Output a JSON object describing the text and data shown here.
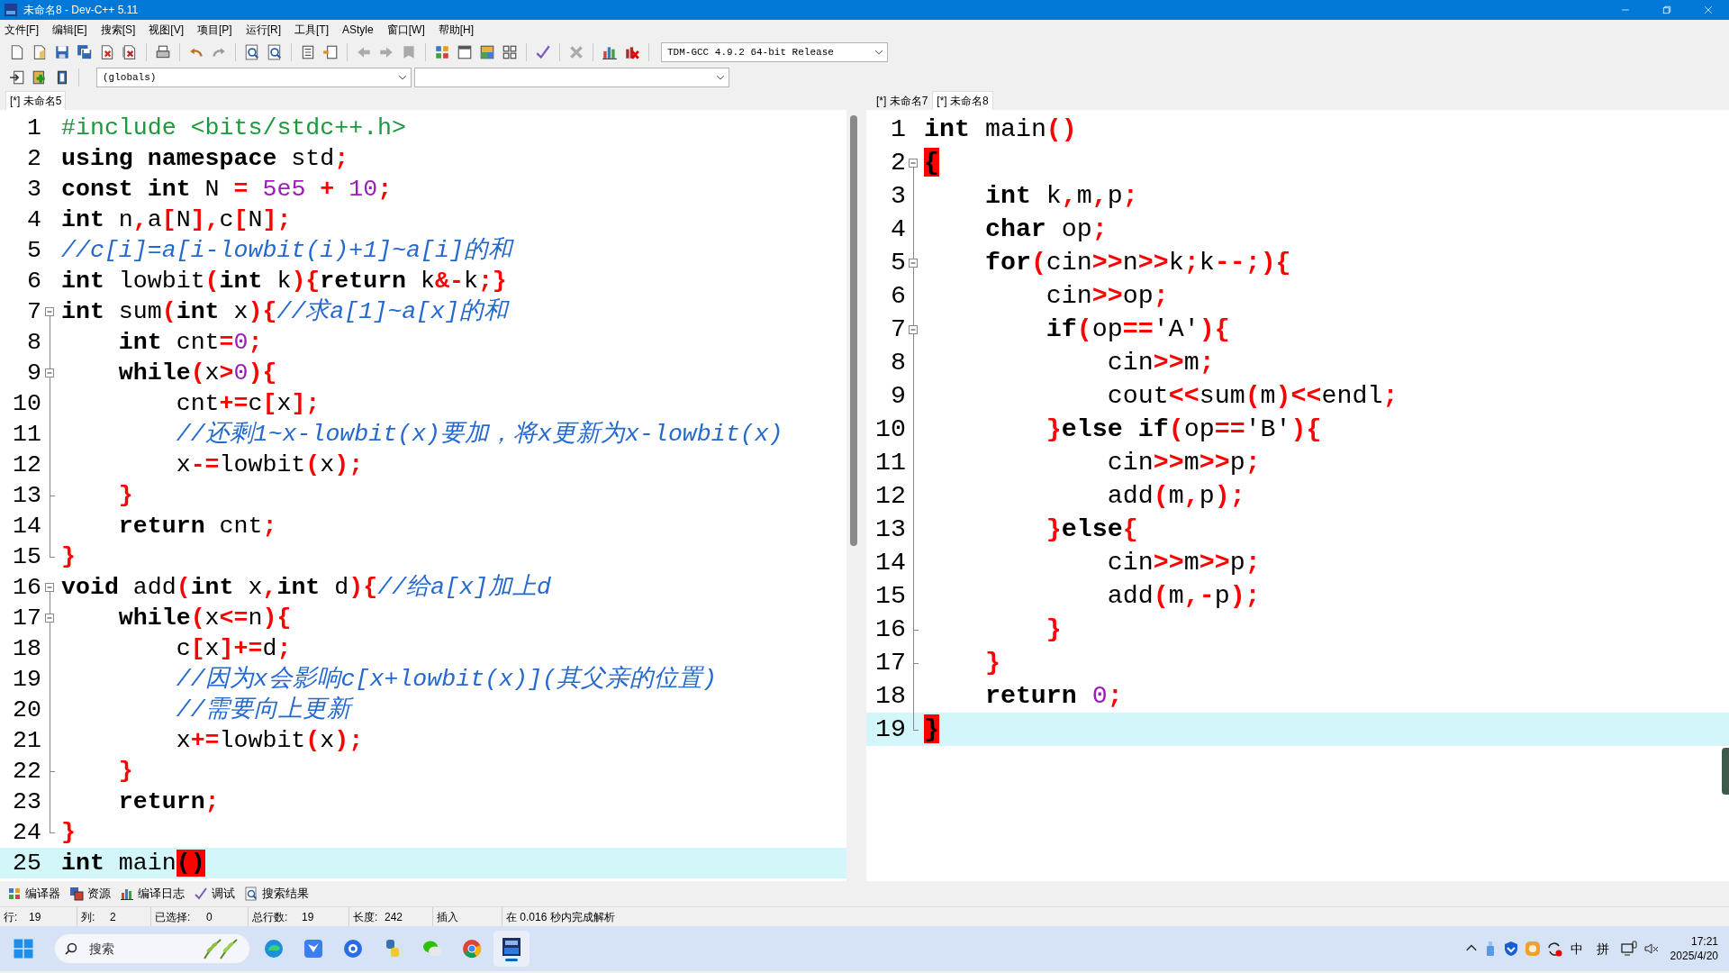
{
  "window": {
    "title": "未命名8 - Dev-C++ 5.11"
  },
  "menu": [
    "文件[F]",
    "编辑[E]",
    "搜索[S]",
    "视图[V]",
    "项目[P]",
    "运行[R]",
    "工具[T]",
    "AStyle",
    "窗口[W]",
    "帮助[H]"
  ],
  "toolbar": {
    "compiler": "TDM-GCC 4.9.2 64-bit Release",
    "scope": "(globals)"
  },
  "editors": [
    {
      "tabs": [
        {
          "label": "[*] 未命名5",
          "selected": true
        }
      ],
      "lines": [
        {
          "n": "1",
          "current": false,
          "t": [
            {
              "kind": "preprocessor",
              "text": "#include <bits/stdc++.h>"
            }
          ]
        },
        {
          "n": "2",
          "current": false,
          "t": [
            {
              "kind": "keyword",
              "text": "using"
            },
            {
              "kind": "keyword",
              "text": " namespace"
            },
            {
              "kind": "plain",
              "text": " std"
            },
            {
              "kind": "symbol",
              "text": ";"
            }
          ]
        },
        {
          "n": "3",
          "current": false,
          "t": [
            {
              "kind": "keyword",
              "text": "const"
            },
            {
              "kind": "keyword",
              "text": " int"
            },
            {
              "kind": "plain",
              "text": " N "
            },
            {
              "kind": "symbol",
              "text": "="
            },
            {
              "kind": "number",
              "text": " 5e5"
            },
            {
              "kind": "symbol",
              "text": " +"
            },
            {
              "kind": "number",
              "text": " 10"
            },
            {
              "kind": "symbol",
              "text": ";"
            }
          ]
        },
        {
          "n": "4",
          "current": false,
          "t": [
            {
              "kind": "keyword",
              "text": "int"
            },
            {
              "kind": "plain",
              "text": " n"
            },
            {
              "kind": "symbol",
              "text": ","
            },
            {
              "kind": "plain",
              "text": "a"
            },
            {
              "kind": "symbol",
              "text": "["
            },
            {
              "kind": "plain",
              "text": "N"
            },
            {
              "kind": "symbol",
              "text": "],"
            },
            {
              "kind": "plain",
              "text": "c"
            },
            {
              "kind": "symbol",
              "text": "["
            },
            {
              "kind": "plain",
              "text": "N"
            },
            {
              "kind": "symbol",
              "text": "];"
            }
          ]
        },
        {
          "n": "5",
          "current": false,
          "t": [
            {
              "kind": "comment",
              "text": "//c[i]=a[i-lowbit(i)+1]~a[i]的和"
            }
          ]
        },
        {
          "n": "6",
          "current": false,
          "t": [
            {
              "kind": "keyword",
              "text": "int"
            },
            {
              "kind": "plain",
              "text": " lowbit"
            },
            {
              "kind": "symbol",
              "text": "("
            },
            {
              "kind": "keyword",
              "text": "int"
            },
            {
              "kind": "plain",
              "text": " k"
            },
            {
              "kind": "symbol",
              "text": "){"
            },
            {
              "kind": "keyword",
              "text": "return"
            },
            {
              "kind": "plain",
              "text": " k"
            },
            {
              "kind": "symbol",
              "text": "&-"
            },
            {
              "kind": "plain",
              "text": "k"
            },
            {
              "kind": "symbol",
              "text": ";}"
            }
          ]
        },
        {
          "n": "7",
          "current": false,
          "fold": {
            "kind": "start"
          },
          "t": [
            {
              "kind": "keyword",
              "text": "int"
            },
            {
              "kind": "plain",
              "text": " sum"
            },
            {
              "kind": "symbol",
              "text": "("
            },
            {
              "kind": "keyword",
              "text": "int"
            },
            {
              "kind": "plain",
              "text": " x"
            },
            {
              "kind": "symbol",
              "text": "){"
            },
            {
              "kind": "comment",
              "text": "//求a[1]~a[x]的和"
            }
          ]
        },
        {
          "n": "8",
          "current": false,
          "t": [
            {
              "kind": "keyword",
              "text": "    int"
            },
            {
              "kind": "plain",
              "text": " cnt"
            },
            {
              "kind": "symbol",
              "text": "="
            },
            {
              "kind": "number",
              "text": "0"
            },
            {
              "kind": "symbol",
              "text": ";"
            }
          ]
        },
        {
          "n": "9",
          "current": false,
          "fold": {
            "kind": "start"
          },
          "t": [
            {
              "kind": "keyword",
              "text": "    while"
            },
            {
              "kind": "symbol",
              "text": "("
            },
            {
              "kind": "plain",
              "text": "x"
            },
            {
              "kind": "symbol",
              "text": ">"
            },
            {
              "kind": "number",
              "text": "0"
            },
            {
              "kind": "symbol",
              "text": "){"
            }
          ]
        },
        {
          "n": "10",
          "current": false,
          "t": [
            {
              "kind": "plain",
              "text": "        cnt"
            },
            {
              "kind": "symbol",
              "text": "+="
            },
            {
              "kind": "plain",
              "text": "c"
            },
            {
              "kind": "symbol",
              "text": "["
            },
            {
              "kind": "plain",
              "text": "x"
            },
            {
              "kind": "symbol",
              "text": "];"
            }
          ]
        },
        {
          "n": "11",
          "current": false,
          "t": [
            {
              "kind": "comment",
              "text": "        //还剩1~x-lowbit(x)要加，将x更新为x-lowbit(x)"
            }
          ]
        },
        {
          "n": "12",
          "current": false,
          "t": [
            {
              "kind": "plain",
              "text": "        x"
            },
            {
              "kind": "symbol",
              "text": "-="
            },
            {
              "kind": "plain",
              "text": "lowbit"
            },
            {
              "kind": "symbol",
              "text": "("
            },
            {
              "kind": "plain",
              "text": "x"
            },
            {
              "kind": "symbol",
              "text": ");"
            }
          ]
        },
        {
          "n": "13",
          "current": false,
          "fold": {
            "kind": "end"
          },
          "t": [
            {
              "kind": "symbol",
              "text": "    }"
            }
          ]
        },
        {
          "n": "14",
          "current": false,
          "t": [
            {
              "kind": "keyword",
              "text": "    return"
            },
            {
              "kind": "plain",
              "text": " cnt"
            },
            {
              "kind": "symbol",
              "text": ";"
            }
          ]
        },
        {
          "n": "15",
          "current": false,
          "fold": {
            "kind": "end"
          },
          "t": [
            {
              "kind": "symbol",
              "text": "}"
            }
          ]
        },
        {
          "n": "16",
          "current": false,
          "fold": {
            "kind": "start"
          },
          "t": [
            {
              "kind": "keyword",
              "text": "void"
            },
            {
              "kind": "plain",
              "text": " add"
            },
            {
              "kind": "symbol",
              "text": "("
            },
            {
              "kind": "keyword",
              "text": "int"
            },
            {
              "kind": "plain",
              "text": " x"
            },
            {
              "kind": "symbol",
              "text": ","
            },
            {
              "kind": "keyword",
              "text": "int"
            },
            {
              "kind": "plain",
              "text": " d"
            },
            {
              "kind": "symbol",
              "text": "){"
            },
            {
              "kind": "comment",
              "text": "//给a[x]加上d"
            }
          ]
        },
        {
          "n": "17",
          "current": false,
          "fold": {
            "kind": "start"
          },
          "t": [
            {
              "kind": "keyword",
              "text": "    while"
            },
            {
              "kind": "symbol",
              "text": "("
            },
            {
              "kind": "plain",
              "text": "x"
            },
            {
              "kind": "symbol",
              "text": "<="
            },
            {
              "kind": "plain",
              "text": "n"
            },
            {
              "kind": "symbol",
              "text": "){"
            }
          ]
        },
        {
          "n": "18",
          "current": false,
          "t": [
            {
              "kind": "plain",
              "text": "        c"
            },
            {
              "kind": "symbol",
              "text": "["
            },
            {
              "kind": "plain",
              "text": "x"
            },
            {
              "kind": "symbol",
              "text": "]+="
            },
            {
              "kind": "plain",
              "text": "d"
            },
            {
              "kind": "symbol",
              "text": ";"
            }
          ]
        },
        {
          "n": "19",
          "current": false,
          "t": [
            {
              "kind": "comment",
              "text": "        //因为x会影响c[x+lowbit(x)](其父亲的位置)"
            }
          ]
        },
        {
          "n": "20",
          "current": false,
          "t": [
            {
              "kind": "comment",
              "text": "        //需要向上更新"
            }
          ]
        },
        {
          "n": "21",
          "current": false,
          "t": [
            {
              "kind": "plain",
              "text": "        x"
            },
            {
              "kind": "symbol",
              "text": "+="
            },
            {
              "kind": "plain",
              "text": "lowbit"
            },
            {
              "kind": "symbol",
              "text": "("
            },
            {
              "kind": "plain",
              "text": "x"
            },
            {
              "kind": "symbol",
              "text": ");"
            }
          ]
        },
        {
          "n": "22",
          "current": false,
          "fold": {
            "kind": "end"
          },
          "t": [
            {
              "kind": "symbol",
              "text": "    }"
            }
          ]
        },
        {
          "n": "23",
          "current": false,
          "t": [
            {
              "kind": "keyword",
              "text": "    return"
            },
            {
              "kind": "symbol",
              "text": ";"
            }
          ]
        },
        {
          "n": "24",
          "current": false,
          "fold": {
            "kind": "end"
          },
          "t": [
            {
              "kind": "symbol",
              "text": "}"
            }
          ]
        },
        {
          "n": "25",
          "current": true,
          "t": [
            {
              "kind": "keyword",
              "text": "int"
            },
            {
              "kind": "plain",
              "text": " main"
            },
            {
              "kind": "match",
              "text": "()"
            }
          ]
        }
      ]
    },
    {
      "tabs": [
        {
          "label": "[*] 未命名7",
          "selected": false
        },
        {
          "label": "[*] 未命名8",
          "selected": true
        }
      ],
      "lines": [
        {
          "n": "1",
          "current": false,
          "t": [
            {
              "kind": "keyword",
              "text": "int"
            },
            {
              "kind": "plain",
              "text": " main"
            },
            {
              "kind": "symbol",
              "text": "()"
            }
          ]
        },
        {
          "n": "2",
          "current": false,
          "fold": {
            "kind": "start"
          },
          "t": [
            {
              "kind": "match",
              "text": "{"
            }
          ]
        },
        {
          "n": "3",
          "current": false,
          "t": [
            {
              "kind": "keyword",
              "text": "    int"
            },
            {
              "kind": "plain",
              "text": " k"
            },
            {
              "kind": "symbol",
              "text": ","
            },
            {
              "kind": "plain",
              "text": "m"
            },
            {
              "kind": "symbol",
              "text": ","
            },
            {
              "kind": "plain",
              "text": "p"
            },
            {
              "kind": "symbol",
              "text": ";"
            }
          ]
        },
        {
          "n": "4",
          "current": false,
          "t": [
            {
              "kind": "keyword",
              "text": "    char"
            },
            {
              "kind": "plain",
              "text": " op"
            },
            {
              "kind": "symbol",
              "text": ";"
            }
          ]
        },
        {
          "n": "5",
          "current": false,
          "fold": {
            "kind": "start"
          },
          "t": [
            {
              "kind": "keyword",
              "text": "    for"
            },
            {
              "kind": "symbol",
              "text": "("
            },
            {
              "kind": "plain",
              "text": "cin"
            },
            {
              "kind": "symbol",
              "text": ">>"
            },
            {
              "kind": "plain",
              "text": "n"
            },
            {
              "kind": "symbol",
              "text": ">>"
            },
            {
              "kind": "plain",
              "text": "k"
            },
            {
              "kind": "symbol",
              "text": ";"
            },
            {
              "kind": "plain",
              "text": "k"
            },
            {
              "kind": "symbol",
              "text": "--;){"
            }
          ]
        },
        {
          "n": "6",
          "current": false,
          "t": [
            {
              "kind": "plain",
              "text": "        cin"
            },
            {
              "kind": "symbol",
              "text": ">>"
            },
            {
              "kind": "plain",
              "text": "op"
            },
            {
              "kind": "symbol",
              "text": ";"
            }
          ]
        },
        {
          "n": "7",
          "current": false,
          "fold": {
            "kind": "start"
          },
          "t": [
            {
              "kind": "keyword",
              "text": "        if"
            },
            {
              "kind": "symbol",
              "text": "("
            },
            {
              "kind": "plain",
              "text": "op"
            },
            {
              "kind": "symbol",
              "text": "=="
            },
            {
              "kind": "plain",
              "text": "'A'"
            },
            {
              "kind": "symbol",
              "text": "){"
            }
          ]
        },
        {
          "n": "8",
          "current": false,
          "t": [
            {
              "kind": "plain",
              "text": "            cin"
            },
            {
              "kind": "symbol",
              "text": ">>"
            },
            {
              "kind": "plain",
              "text": "m"
            },
            {
              "kind": "symbol",
              "text": ";"
            }
          ]
        },
        {
          "n": "9",
          "current": false,
          "t": [
            {
              "kind": "plain",
              "text": "            cout"
            },
            {
              "kind": "symbol",
              "text": "<<"
            },
            {
              "kind": "plain",
              "text": "sum"
            },
            {
              "kind": "symbol",
              "text": "("
            },
            {
              "kind": "plain",
              "text": "m"
            },
            {
              "kind": "symbol",
              "text": ")<<"
            },
            {
              "kind": "plain",
              "text": "endl"
            },
            {
              "kind": "symbol",
              "text": ";"
            }
          ]
        },
        {
          "n": "10",
          "current": false,
          "t": [
            {
              "kind": "symbol",
              "text": "        }"
            },
            {
              "kind": "keyword",
              "text": "else if"
            },
            {
              "kind": "symbol",
              "text": "("
            },
            {
              "kind": "plain",
              "text": "op"
            },
            {
              "kind": "symbol",
              "text": "=="
            },
            {
              "kind": "plain",
              "text": "'B'"
            },
            {
              "kind": "symbol",
              "text": "){"
            }
          ]
        },
        {
          "n": "11",
          "current": false,
          "t": [
            {
              "kind": "plain",
              "text": "            cin"
            },
            {
              "kind": "symbol",
              "text": ">>"
            },
            {
              "kind": "plain",
              "text": "m"
            },
            {
              "kind": "symbol",
              "text": ">>"
            },
            {
              "kind": "plain",
              "text": "p"
            },
            {
              "kind": "symbol",
              "text": ";"
            }
          ]
        },
        {
          "n": "12",
          "current": false,
          "t": [
            {
              "kind": "plain",
              "text": "            add"
            },
            {
              "kind": "symbol",
              "text": "("
            },
            {
              "kind": "plain",
              "text": "m"
            },
            {
              "kind": "symbol",
              "text": ","
            },
            {
              "kind": "plain",
              "text": "p"
            },
            {
              "kind": "symbol",
              "text": ");"
            }
          ]
        },
        {
          "n": "13",
          "current": false,
          "t": [
            {
              "kind": "symbol",
              "text": "        }"
            },
            {
              "kind": "keyword",
              "text": "else"
            },
            {
              "kind": "symbol",
              "text": "{"
            }
          ]
        },
        {
          "n": "14",
          "current": false,
          "t": [
            {
              "kind": "plain",
              "text": "            cin"
            },
            {
              "kind": "symbol",
              "text": ">>"
            },
            {
              "kind": "plain",
              "text": "m"
            },
            {
              "kind": "symbol",
              "text": ">>"
            },
            {
              "kind": "plain",
              "text": "p"
            },
            {
              "kind": "symbol",
              "text": ";"
            }
          ]
        },
        {
          "n": "15",
          "current": false,
          "t": [
            {
              "kind": "plain",
              "text": "            add"
            },
            {
              "kind": "symbol",
              "text": "("
            },
            {
              "kind": "plain",
              "text": "m"
            },
            {
              "kind": "symbol",
              "text": ",-"
            },
            {
              "kind": "plain",
              "text": "p"
            },
            {
              "kind": "symbol",
              "text": ");"
            }
          ]
        },
        {
          "n": "16",
          "current": false,
          "fold": {
            "kind": "end"
          },
          "t": [
            {
              "kind": "symbol",
              "text": "        }"
            }
          ]
        },
        {
          "n": "17",
          "current": false,
          "fold": {
            "kind": "end"
          },
          "t": [
            {
              "kind": "symbol",
              "text": "    }"
            }
          ]
        },
        {
          "n": "18",
          "current": false,
          "t": [
            {
              "kind": "keyword",
              "text": "    return"
            },
            {
              "kind": "number",
              "text": " 0"
            },
            {
              "kind": "symbol",
              "text": ";"
            }
          ]
        },
        {
          "n": "19",
          "current": true,
          "fold": {
            "kind": "end"
          },
          "t": [
            {
              "kind": "match",
              "text": "}"
            }
          ]
        }
      ]
    }
  ],
  "bottom_tabs": [
    "编译器",
    "资源",
    "编译日志",
    "调试",
    "搜索结果"
  ],
  "status_bar": [
    {
      "label": "行:",
      "value": "19"
    },
    {
      "label": "列:",
      "value": "2"
    },
    {
      "label": "已选择:",
      "value": "0"
    },
    {
      "label": "总行数:",
      "value": "19"
    },
    {
      "label": "长度:",
      "value": "242"
    },
    {
      "value": "插入"
    },
    {
      "value": "在 0.016 秒内完成解析"
    }
  ],
  "taskbar": {
    "search": {
      "placeholder": "搜索"
    },
    "apps": [
      {
        "selected": false
      },
      {
        "selected": false
      },
      {
        "selected": false
      },
      {
        "selected": false
      },
      {
        "selected": false
      },
      {
        "selected": false
      },
      {
        "selected": true
      }
    ],
    "input_mode": "中",
    "ime": "拼",
    "time": "17:21",
    "date": "2025/4/20"
  }
}
